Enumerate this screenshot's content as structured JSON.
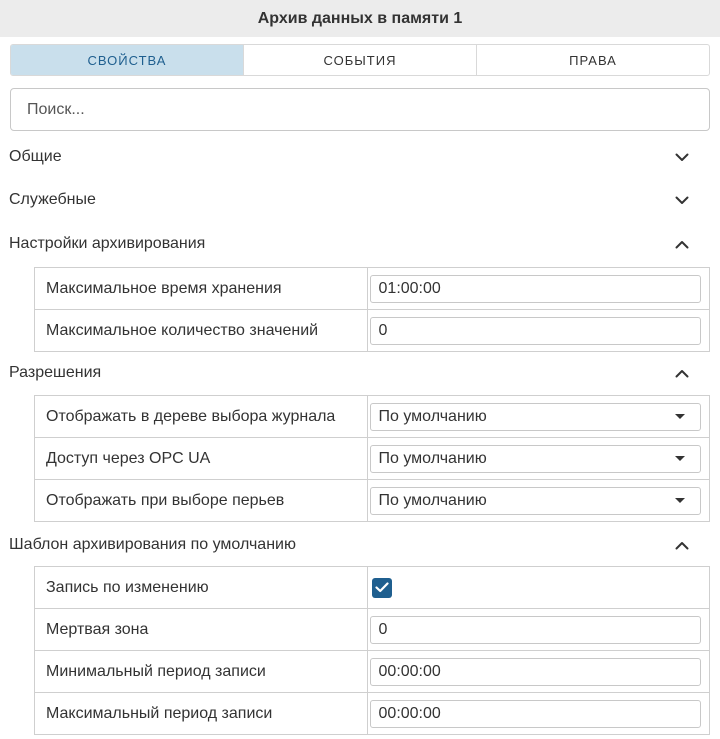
{
  "title": "Архив данных в памяти 1",
  "tabs": [
    {
      "label": "СВОЙСТВА",
      "active": true
    },
    {
      "label": "СОБЫТИЯ",
      "active": false
    },
    {
      "label": "ПРАВА",
      "active": false
    }
  ],
  "search": {
    "placeholder": "Поиск...",
    "value": ""
  },
  "sections": {
    "general": {
      "title": "Общие",
      "expanded": false
    },
    "service": {
      "title": "Служебные",
      "expanded": false
    },
    "archiving": {
      "title": "Настройки архивирования",
      "expanded": true,
      "rows": [
        {
          "label": "Максимальное время хранения",
          "value": "01:00:00"
        },
        {
          "label": "Максимальное количество значений",
          "value": "0"
        }
      ]
    },
    "permissions": {
      "title": "Разрешения",
      "expanded": true,
      "rows": [
        {
          "label": "Отображать в дереве выбора журнала",
          "value": "По умолчанию"
        },
        {
          "label": "Доступ через OPC UA",
          "value": "По умолчанию"
        },
        {
          "label": "Отображать при выборе перьев",
          "value": "По умолчанию"
        }
      ]
    },
    "template": {
      "title": "Шаблон архивирования по умолчанию",
      "expanded": true,
      "rows": [
        {
          "label": "Запись по изменению",
          "checked": true
        },
        {
          "label": "Мертвая зона",
          "value": "0"
        },
        {
          "label": "Минимальный период записи",
          "value": "00:00:00"
        },
        {
          "label": "Максимальный период записи",
          "value": "00:00:00"
        }
      ]
    }
  },
  "colors": {
    "accent": "#1f5f8f",
    "active_tab_bg": "#c9dfec",
    "titlebar_bg": "#ececec"
  }
}
